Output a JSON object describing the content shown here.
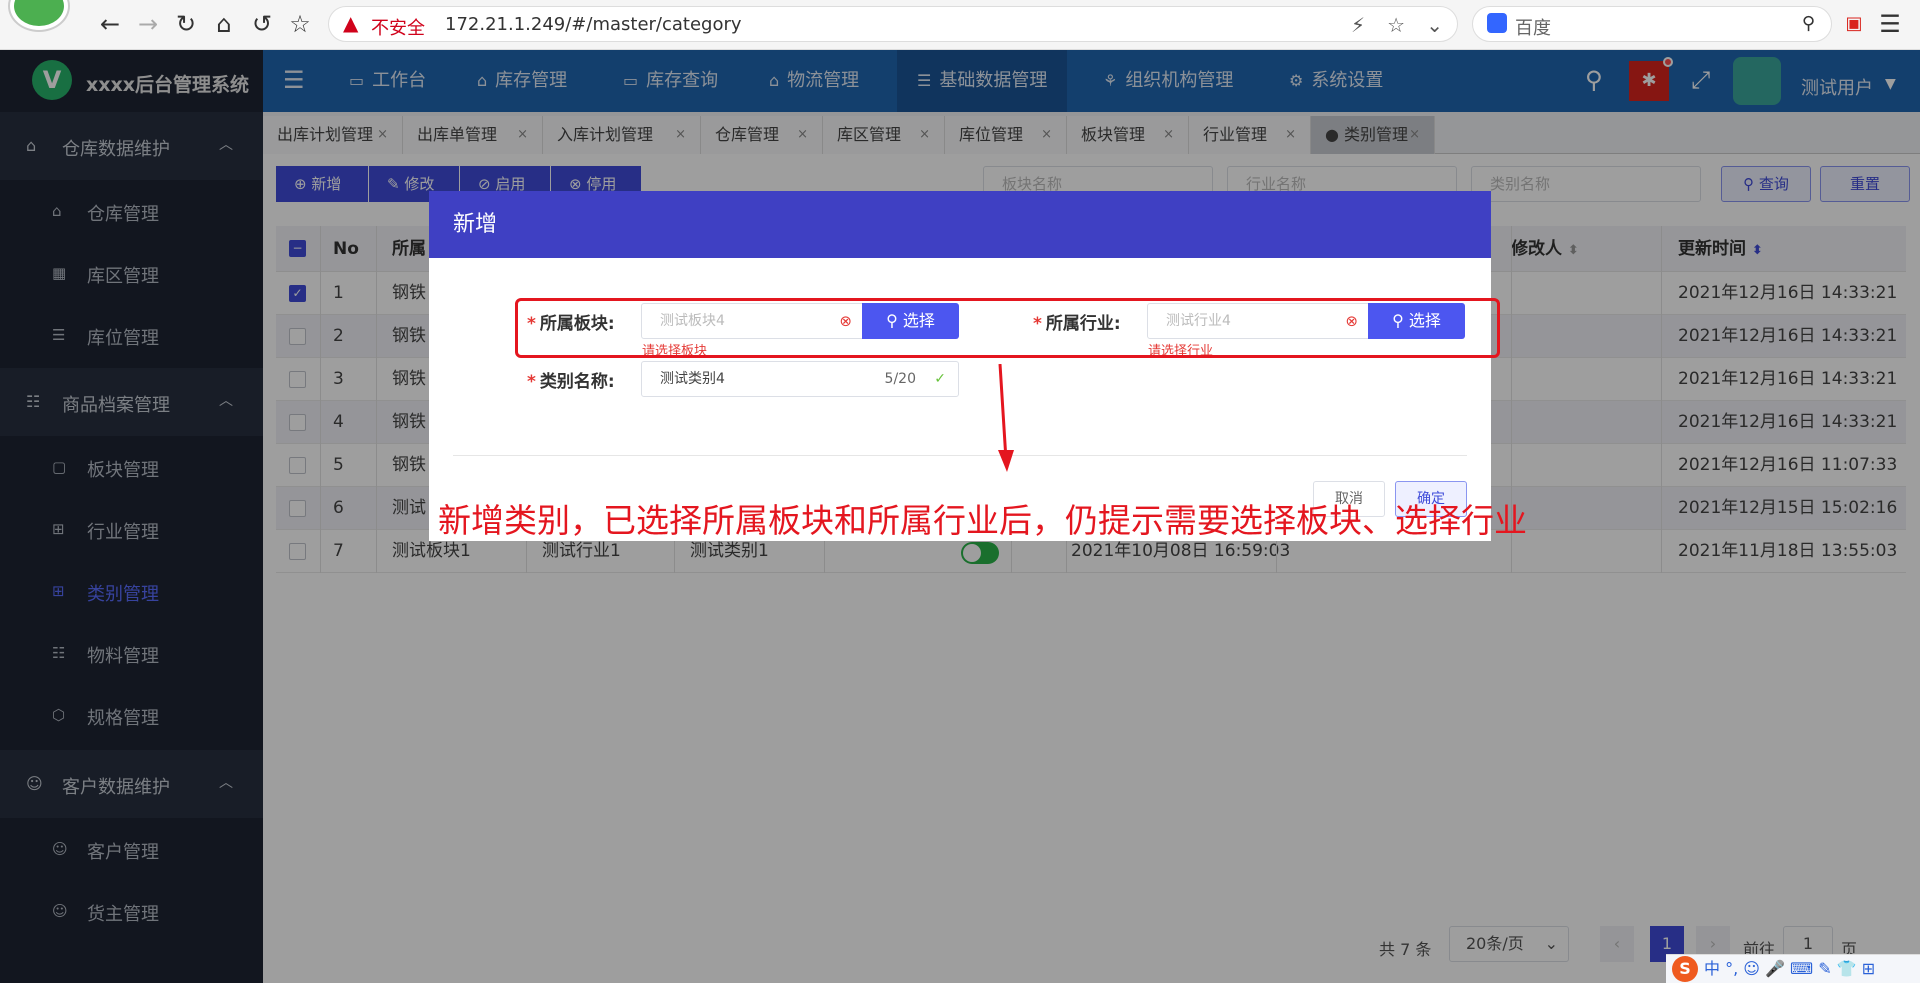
{
  "browser": {
    "insecure_label": "不安全",
    "url": "172.21.1.249/#/master/category",
    "search_placeholder": "百度"
  },
  "app": {
    "name": "xxxx后台管理系统",
    "logo_letter": "V",
    "user": "测试用户"
  },
  "sidebar": {
    "groups": [
      {
        "label": "仓库数据维护",
        "items": [
          "仓库管理",
          "库区管理",
          "库位管理"
        ]
      },
      {
        "label": "商品档案管理",
        "items": [
          "板块管理",
          "行业管理",
          "类别管理",
          "物料管理",
          "规格管理"
        ]
      },
      {
        "label": "客户数据维护",
        "items": [
          "客户管理",
          "货主管理"
        ]
      }
    ],
    "active_item": "类别管理"
  },
  "topnav": [
    "工作台",
    "库存管理",
    "库存查询",
    "物流管理",
    "基础数据管理",
    "组织机构管理",
    "系统设置"
  ],
  "tabs": [
    "出库计划管理",
    "出库单管理",
    "入库计划管理",
    "仓库管理",
    "库区管理",
    "库位管理",
    "板块管理",
    "行业管理",
    "类别管理"
  ],
  "toolbar": {
    "add": "新增",
    "edit": "修改",
    "enable": "启用",
    "disable": "停用",
    "ph_block": "板块名称",
    "ph_industry": "行业名称",
    "ph_category": "类别名称",
    "query": "查询",
    "reset": "重置"
  },
  "table": {
    "headers": {
      "no": "No",
      "block": "所属",
      "modifier": "修改人",
      "updated": "更新时间"
    },
    "rows": [
      {
        "no": "1",
        "block": "钢铁",
        "industry": "",
        "category": "",
        "created": "",
        "updated": "2021年12月16日 14:33:21",
        "checked": true
      },
      {
        "no": "2",
        "block": "钢铁",
        "industry": "",
        "category": "",
        "created": "",
        "updated": "2021年12月16日 14:33:21"
      },
      {
        "no": "3",
        "block": "钢铁",
        "industry": "",
        "category": "",
        "created": "",
        "updated": "2021年12月16日 14:33:21"
      },
      {
        "no": "4",
        "block": "钢铁",
        "industry": "",
        "category": "",
        "created": "",
        "updated": "2021年12月16日 14:33:21"
      },
      {
        "no": "5",
        "block": "钢铁",
        "industry": "",
        "category": "",
        "created": "",
        "updated": "2021年12月16日 11:07:33"
      },
      {
        "no": "6",
        "block": "测试",
        "industry": "",
        "category": "",
        "created": "",
        "updated": "2021年12月15日 15:02:16"
      },
      {
        "no": "7",
        "block": "测试板块1",
        "industry": "测试行业1",
        "category": "测试类别1",
        "created": "2021年10月08日 16:59:03",
        "updated": "2021年11月18日 13:55:03"
      }
    ]
  },
  "pager": {
    "total": "共 7 条",
    "size": "20条/页",
    "page": "1",
    "goto": "前往",
    "goto_value": "1",
    "page_unit": "页"
  },
  "dialog": {
    "title": "新增",
    "block_label": "所属板块:",
    "block_value": "测试板块4",
    "block_error": "请选择板块",
    "industry_label": "所属行业:",
    "industry_value": "测试行业4",
    "industry_error": "请选择行业",
    "category_label": "类别名称:",
    "category_value": "测试类别4",
    "category_count": "5/20",
    "select": "选择",
    "cancel": "取消",
    "confirm": "确定"
  },
  "annotation": "新增类别，已选择所属板块和所属行业后，仍提示需要选择板块、选择行业",
  "ime": {
    "label": "中 °,"
  }
}
